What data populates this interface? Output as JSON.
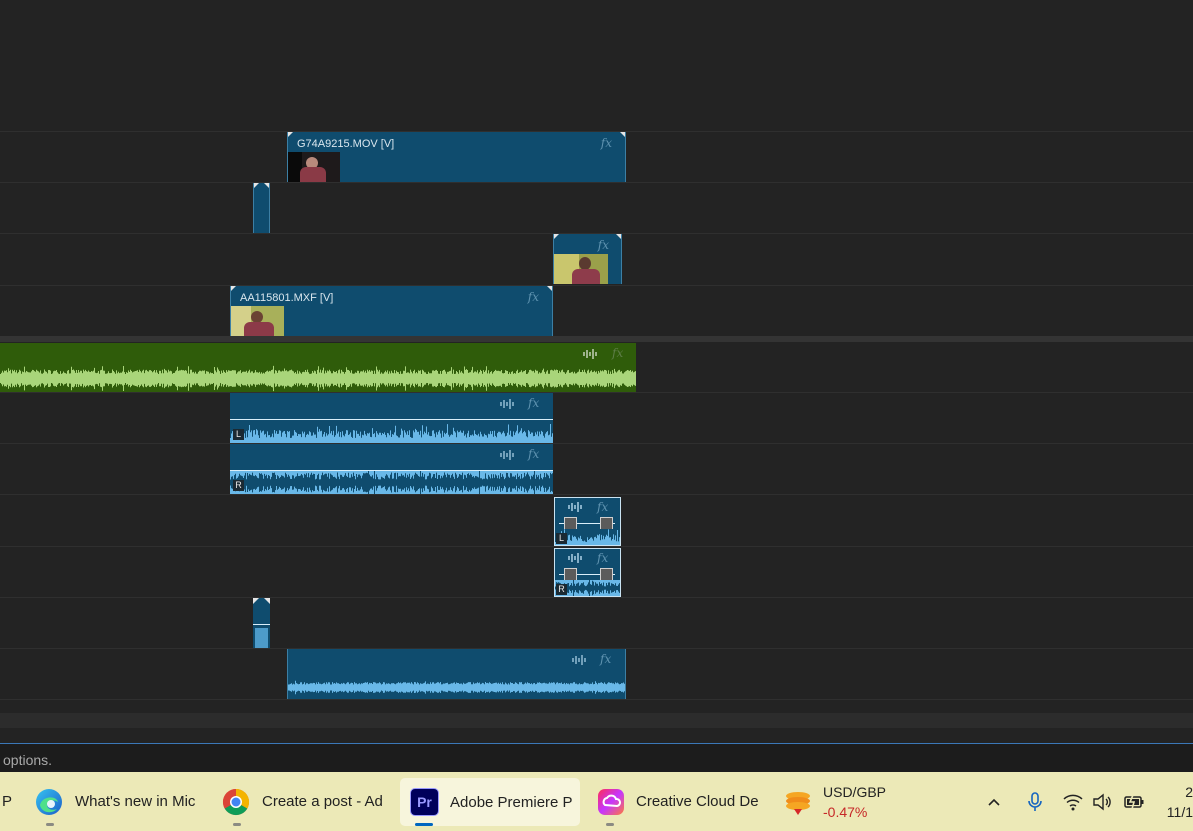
{
  "tracks": {
    "video": [
      {
        "name": "G74A9215.MOV [V]"
      },
      {
        "name": ""
      },
      {
        "name": ""
      },
      {
        "name": "AA115801.MXF [V]"
      }
    ],
    "audio_channels": [
      "L",
      "R",
      "L",
      "R"
    ],
    "fx_label": "fx"
  },
  "status_bar": {
    "text": "options."
  },
  "taskbar": {
    "edge_partial": "P",
    "apps": [
      {
        "label": "What's new in Mic",
        "icon": "edge-icon"
      },
      {
        "label": "Create a post - Ad",
        "icon": "chrome-icon"
      },
      {
        "label": "Adobe Premiere P",
        "icon": "premiere-icon",
        "icon_text": "Pr"
      },
      {
        "label": "Creative Cloud De",
        "icon": "creative-cloud-icon"
      }
    ],
    "widget": {
      "title": "USD/GBP",
      "value": "-0.47%"
    },
    "clock": {
      "time": "2",
      "date": "11/1"
    }
  },
  "colors": {
    "video_clip": "#0f4c6e",
    "audio_clip_selected": "#69b8e8",
    "music_track": "#2f5c0a",
    "widget_negative": "#c62828"
  }
}
